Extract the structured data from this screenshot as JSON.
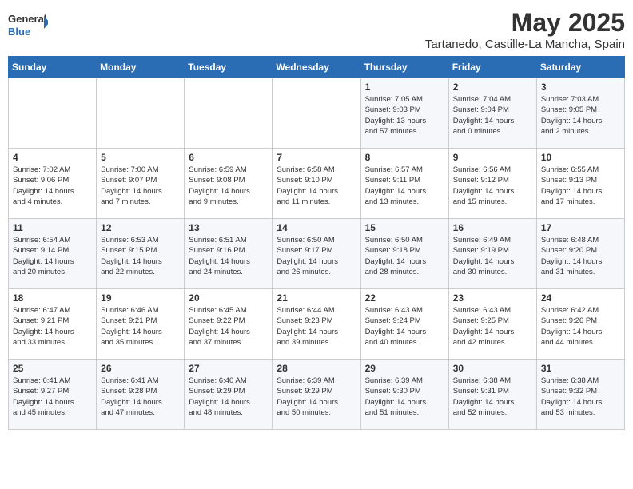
{
  "logo": {
    "general": "General",
    "blue": "Blue"
  },
  "title": "May 2025",
  "subtitle": "Tartanedo, Castille-La Mancha, Spain",
  "headers": [
    "Sunday",
    "Monday",
    "Tuesday",
    "Wednesday",
    "Thursday",
    "Friday",
    "Saturday"
  ],
  "weeks": [
    [
      {
        "num": "",
        "info": ""
      },
      {
        "num": "",
        "info": ""
      },
      {
        "num": "",
        "info": ""
      },
      {
        "num": "",
        "info": ""
      },
      {
        "num": "1",
        "info": "Sunrise: 7:05 AM\nSunset: 9:03 PM\nDaylight: 13 hours\nand 57 minutes."
      },
      {
        "num": "2",
        "info": "Sunrise: 7:04 AM\nSunset: 9:04 PM\nDaylight: 14 hours\nand 0 minutes."
      },
      {
        "num": "3",
        "info": "Sunrise: 7:03 AM\nSunset: 9:05 PM\nDaylight: 14 hours\nand 2 minutes."
      }
    ],
    [
      {
        "num": "4",
        "info": "Sunrise: 7:02 AM\nSunset: 9:06 PM\nDaylight: 14 hours\nand 4 minutes."
      },
      {
        "num": "5",
        "info": "Sunrise: 7:00 AM\nSunset: 9:07 PM\nDaylight: 14 hours\nand 7 minutes."
      },
      {
        "num": "6",
        "info": "Sunrise: 6:59 AM\nSunset: 9:08 PM\nDaylight: 14 hours\nand 9 minutes."
      },
      {
        "num": "7",
        "info": "Sunrise: 6:58 AM\nSunset: 9:10 PM\nDaylight: 14 hours\nand 11 minutes."
      },
      {
        "num": "8",
        "info": "Sunrise: 6:57 AM\nSunset: 9:11 PM\nDaylight: 14 hours\nand 13 minutes."
      },
      {
        "num": "9",
        "info": "Sunrise: 6:56 AM\nSunset: 9:12 PM\nDaylight: 14 hours\nand 15 minutes."
      },
      {
        "num": "10",
        "info": "Sunrise: 6:55 AM\nSunset: 9:13 PM\nDaylight: 14 hours\nand 17 minutes."
      }
    ],
    [
      {
        "num": "11",
        "info": "Sunrise: 6:54 AM\nSunset: 9:14 PM\nDaylight: 14 hours\nand 20 minutes."
      },
      {
        "num": "12",
        "info": "Sunrise: 6:53 AM\nSunset: 9:15 PM\nDaylight: 14 hours\nand 22 minutes."
      },
      {
        "num": "13",
        "info": "Sunrise: 6:51 AM\nSunset: 9:16 PM\nDaylight: 14 hours\nand 24 minutes."
      },
      {
        "num": "14",
        "info": "Sunrise: 6:50 AM\nSunset: 9:17 PM\nDaylight: 14 hours\nand 26 minutes."
      },
      {
        "num": "15",
        "info": "Sunrise: 6:50 AM\nSunset: 9:18 PM\nDaylight: 14 hours\nand 28 minutes."
      },
      {
        "num": "16",
        "info": "Sunrise: 6:49 AM\nSunset: 9:19 PM\nDaylight: 14 hours\nand 30 minutes."
      },
      {
        "num": "17",
        "info": "Sunrise: 6:48 AM\nSunset: 9:20 PM\nDaylight: 14 hours\nand 31 minutes."
      }
    ],
    [
      {
        "num": "18",
        "info": "Sunrise: 6:47 AM\nSunset: 9:21 PM\nDaylight: 14 hours\nand 33 minutes."
      },
      {
        "num": "19",
        "info": "Sunrise: 6:46 AM\nSunset: 9:21 PM\nDaylight: 14 hours\nand 35 minutes."
      },
      {
        "num": "20",
        "info": "Sunrise: 6:45 AM\nSunset: 9:22 PM\nDaylight: 14 hours\nand 37 minutes."
      },
      {
        "num": "21",
        "info": "Sunrise: 6:44 AM\nSunset: 9:23 PM\nDaylight: 14 hours\nand 39 minutes."
      },
      {
        "num": "22",
        "info": "Sunrise: 6:43 AM\nSunset: 9:24 PM\nDaylight: 14 hours\nand 40 minutes."
      },
      {
        "num": "23",
        "info": "Sunrise: 6:43 AM\nSunset: 9:25 PM\nDaylight: 14 hours\nand 42 minutes."
      },
      {
        "num": "24",
        "info": "Sunrise: 6:42 AM\nSunset: 9:26 PM\nDaylight: 14 hours\nand 44 minutes."
      }
    ],
    [
      {
        "num": "25",
        "info": "Sunrise: 6:41 AM\nSunset: 9:27 PM\nDaylight: 14 hours\nand 45 minutes."
      },
      {
        "num": "26",
        "info": "Sunrise: 6:41 AM\nSunset: 9:28 PM\nDaylight: 14 hours\nand 47 minutes."
      },
      {
        "num": "27",
        "info": "Sunrise: 6:40 AM\nSunset: 9:29 PM\nDaylight: 14 hours\nand 48 minutes."
      },
      {
        "num": "28",
        "info": "Sunrise: 6:39 AM\nSunset: 9:29 PM\nDaylight: 14 hours\nand 50 minutes."
      },
      {
        "num": "29",
        "info": "Sunrise: 6:39 AM\nSunset: 9:30 PM\nDaylight: 14 hours\nand 51 minutes."
      },
      {
        "num": "30",
        "info": "Sunrise: 6:38 AM\nSunset: 9:31 PM\nDaylight: 14 hours\nand 52 minutes."
      },
      {
        "num": "31",
        "info": "Sunrise: 6:38 AM\nSunset: 9:32 PM\nDaylight: 14 hours\nand 53 minutes."
      }
    ]
  ]
}
